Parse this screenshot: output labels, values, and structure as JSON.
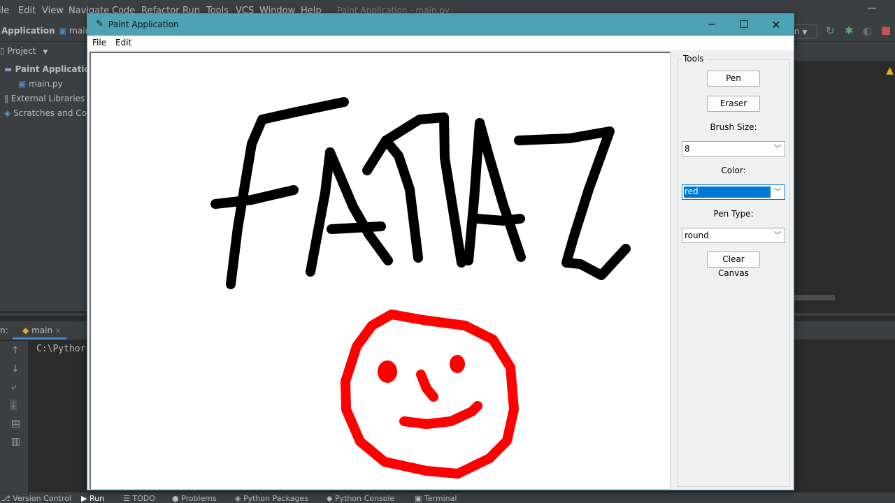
{
  "ide": {
    "menu": [
      "ile",
      "Edit",
      "View",
      "Navigate",
      "Code",
      "Refactor",
      "Run",
      "Tools",
      "VCS",
      "Window",
      "Help"
    ],
    "window_title": "Paint Application - main.py",
    "breadcrumb": {
      "project": "Application",
      "file": "main"
    },
    "run_config_label": "n",
    "project_panel": {
      "header": "Project",
      "tree": [
        "Paint Application",
        "main.py",
        "External Libraries",
        "Scratches and Cor"
      ]
    },
    "run_panel": {
      "label": "n:",
      "tab": "main",
      "console_line": "C:\\Pythor"
    },
    "statusbar": [
      "Version Control",
      "Run",
      "TODO",
      "Problems",
      "Python Packages",
      "Python Console",
      "Terminal"
    ]
  },
  "paint_app": {
    "title": "Paint Application",
    "menu": {
      "file": "File",
      "edit": "Edit"
    },
    "tools": {
      "legend": "Tools",
      "pen_button": "Pen",
      "eraser_button": "Eraser",
      "brush_size_label": "Brush Size:",
      "brush_size_value": "8",
      "color_label": "Color:",
      "color_value": "red",
      "pen_type_label": "Pen Type:",
      "pen_type_value": "round",
      "clear_button": "Clear Canvas"
    },
    "drawing": {
      "text_color": "#000000",
      "smiley_color": "#ff0000",
      "content": [
        "FARAZ",
        "smiley face"
      ]
    }
  },
  "colors": {
    "titlebar": "#4da3b3",
    "ide_dark": "#2b2b2b",
    "ide_panel": "#3c3f41",
    "selection": "#0078d7"
  }
}
